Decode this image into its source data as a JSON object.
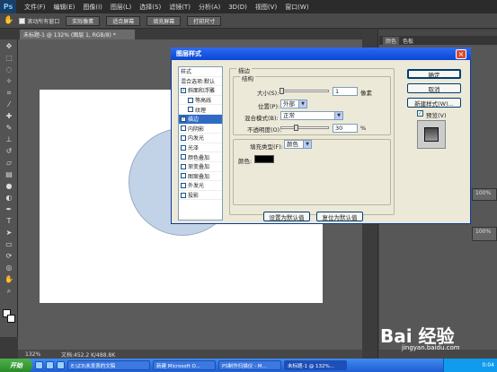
{
  "menubar": {
    "logo": "Ps",
    "items": [
      "文件(F)",
      "编辑(E)",
      "图像(I)",
      "图层(L)",
      "选择(S)",
      "滤镜(T)",
      "分析(A)",
      "3D(D)",
      "视图(V)",
      "窗口(W)"
    ]
  },
  "options": {
    "checkbox_label": "滚动所有窗口",
    "buttons": [
      "实际像素",
      "适合屏幕",
      "填充屏幕",
      "打印尺寸"
    ]
  },
  "document": {
    "tab_title": "未标题-1 @ 132% (图层 1, RGB/8) *",
    "zoom": "132%",
    "doc_size": "文档:452.2 K/488.8K"
  },
  "panels": {
    "tabs": [
      "颜色",
      "色板"
    ],
    "pct1": "100%",
    "pct2": "100%"
  },
  "dialog": {
    "title": "图层样式",
    "close_glyph": "×",
    "style_list": [
      {
        "label": "样式",
        "kind": "head"
      },
      {
        "label": "混合选项:默认",
        "kind": "head"
      },
      {
        "label": "斜面和浮雕",
        "kind": "check",
        "checked": true
      },
      {
        "label": "等高线",
        "kind": "sub",
        "checked": false
      },
      {
        "label": "纹理",
        "kind": "sub",
        "checked": false
      },
      {
        "label": "描边",
        "kind": "check",
        "checked": true,
        "selected": true
      },
      {
        "label": "内阴影",
        "kind": "check",
        "checked": false
      },
      {
        "label": "内发光",
        "kind": "check",
        "checked": false
      },
      {
        "label": "光泽",
        "kind": "check",
        "checked": false
      },
      {
        "label": "颜色叠加",
        "kind": "check",
        "checked": false
      },
      {
        "label": "渐变叠加",
        "kind": "check",
        "checked": false
      },
      {
        "label": "图案叠加",
        "kind": "check",
        "checked": false
      },
      {
        "label": "外发光",
        "kind": "check",
        "checked": false
      },
      {
        "label": "投影",
        "kind": "check",
        "checked": false
      }
    ],
    "stroke_title": "描边",
    "structure_title": "结构",
    "size_label": "大小(S):",
    "size_value": "1",
    "size_unit": "像素",
    "position_label": "位置(P):",
    "position_value": "外部",
    "blend_label": "混合模式(B):",
    "blend_value": "正常",
    "opacity_label": "不透明度(O):",
    "opacity_value": "30",
    "opacity_unit": "%",
    "fill_type_label": "填充类型(F):",
    "fill_type_value": "颜色",
    "color_label": "颜色:",
    "stroke_color": "#000000",
    "set_default_btn": "设置为默认值",
    "reset_default_btn": "复位为默认值",
    "ok_btn": "确定",
    "cancel_btn": "取消",
    "new_style_btn": "新建样式(W)...",
    "preview_label": "预览(V)",
    "preview_checked": true
  },
  "taskbar": {
    "start": "开始",
    "buttons": [
      "E:\\Z3\\未发表的文稿",
      "新建 Microsoft O...",
      "PS制作扫描仪 - M...",
      "未标题-1 @ 132%..."
    ],
    "tray_time": "0:04"
  },
  "watermark": {
    "logo": "Bai 经验",
    "url": "jingyan.baidu.com"
  }
}
